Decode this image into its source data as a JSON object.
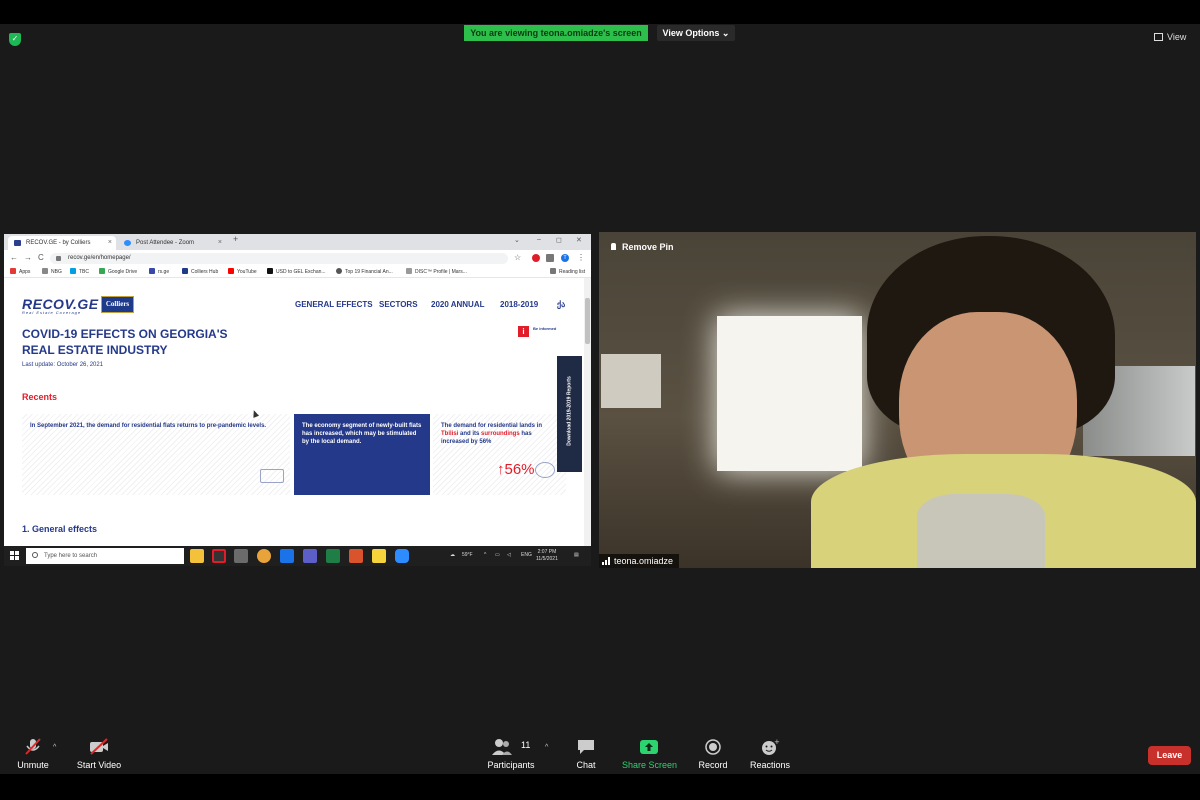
{
  "zoom": {
    "viewing_banner": "You are viewing teona.omiadze's screen",
    "view_options": "View Options",
    "view_options_caret": "⌄",
    "view_label": "View",
    "remove_pin": "Remove Pin",
    "participant_name": "teona.omiadze",
    "participants_count": "11",
    "toolbar": {
      "unmute": "Unmute",
      "start_video": "Start Video",
      "participants": "Participants",
      "chat": "Chat",
      "share_screen": "Share Screen",
      "record": "Record",
      "reactions": "Reactions",
      "leave": "Leave"
    },
    "colors": {
      "banner": "#2dbe4b",
      "leave": "#c8312b",
      "share_green": "#2dd36f"
    }
  },
  "browser": {
    "tabs": [
      {
        "label": "RECOV.GE - by Colliers",
        "close": "×"
      },
      {
        "label": "Post Attendee - Zoom",
        "close": "×"
      }
    ],
    "new_tab": "+",
    "win_minimize": "–",
    "win_maximize": "◻",
    "win_close": "✕",
    "tab_list": "⌄",
    "back": "←",
    "forward": "→",
    "reload": "C",
    "home": "⌂",
    "url": "recov.ge/en/homepage/",
    "star": "☆",
    "profile_letter": "T",
    "more": "⋮",
    "bookmarks": [
      "Apps",
      "NBG",
      "TBC",
      "Google Drive",
      "rs.ge",
      "Colliers Hub",
      "YouTube",
      "USD to GEL Exchan...",
      "Top 19 Financial An...",
      "DISC™ Profile | Mars...",
      "Reading list"
    ]
  },
  "site": {
    "logo": "RECOV.GE",
    "logo_tagline": "Real Estate Coverage",
    "partner_logo": "Colliers",
    "menu": [
      "GENERAL EFFECTS",
      "SECTORS",
      "2020 ANNUAL",
      "2018-2019",
      "ქა"
    ],
    "hero_title": "COVID-19 EFFECTS ON GEORGIA'S REAL ESTATE INDUSTRY",
    "last_update": "Last update: October 26, 2021",
    "be_informed_icon": "i",
    "be_informed": "Be informed",
    "recents": "Recents",
    "cards": [
      {
        "text": "In September 2021, the demand for residential flats returns to pre-pandemic levels."
      },
      {
        "text": "The economy segment of newly-built flats has increased, which may be stimulated by the local demand."
      },
      {
        "pre": "The demand for residential lands in ",
        "city": "Tbilisi",
        "mid": " and its ",
        "area": "surroundings",
        "post": " has increased by 56%",
        "stat": "↑56%"
      }
    ],
    "download_tab": "Download 2019-2019 Reports",
    "section_heading": "1. General effects"
  },
  "taskbar": {
    "search_placeholder": "Type here to search",
    "weather": "59°F",
    "tray_caret": "^",
    "language": "ENG",
    "time": "2:07 PM",
    "date": "11/5/2021"
  }
}
